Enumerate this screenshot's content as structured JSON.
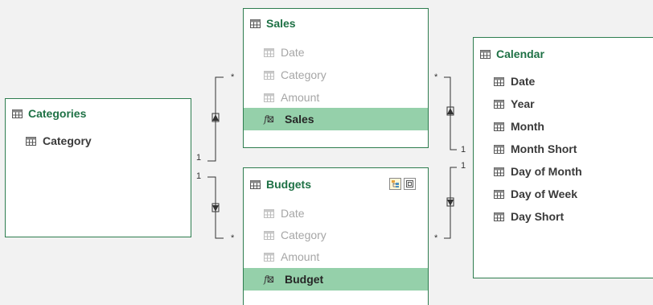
{
  "diagram": {
    "tables": {
      "categories": {
        "name": "Categories",
        "fields": [
          "Category"
        ]
      },
      "sales": {
        "name": "Sales",
        "fields": [
          "Date",
          "Category",
          "Amount"
        ],
        "measure": "Sales"
      },
      "budgets": {
        "name": "Budgets",
        "fields": [
          "Date",
          "Category",
          "Amount"
        ],
        "measure": "Budget"
      },
      "calendar": {
        "name": "Calendar",
        "fields": [
          "Date",
          "Year",
          "Month",
          "Month Short",
          "Day of Month",
          "Day of Week",
          "Day Short"
        ]
      }
    },
    "relationships": {
      "categories_sales": {
        "one": "1",
        "many": "*"
      },
      "categories_budgets": {
        "one": "1",
        "many": "*"
      },
      "calendar_sales": {
        "one": "1",
        "many": "*"
      },
      "calendar_budgets": {
        "one": "1",
        "many": "*"
      }
    },
    "colors": {
      "border": "#2e7d4f",
      "title": "#1e7145",
      "selected_row": "#95d0aa",
      "hidden_field": "#a6a6a6",
      "background": "#f2f2f2"
    },
    "icons": {
      "table": "table-icon",
      "field": "field-icon",
      "measure": "measure-icon",
      "hierarchy": "hierarchy-icon",
      "fit": "fit-icon"
    }
  }
}
